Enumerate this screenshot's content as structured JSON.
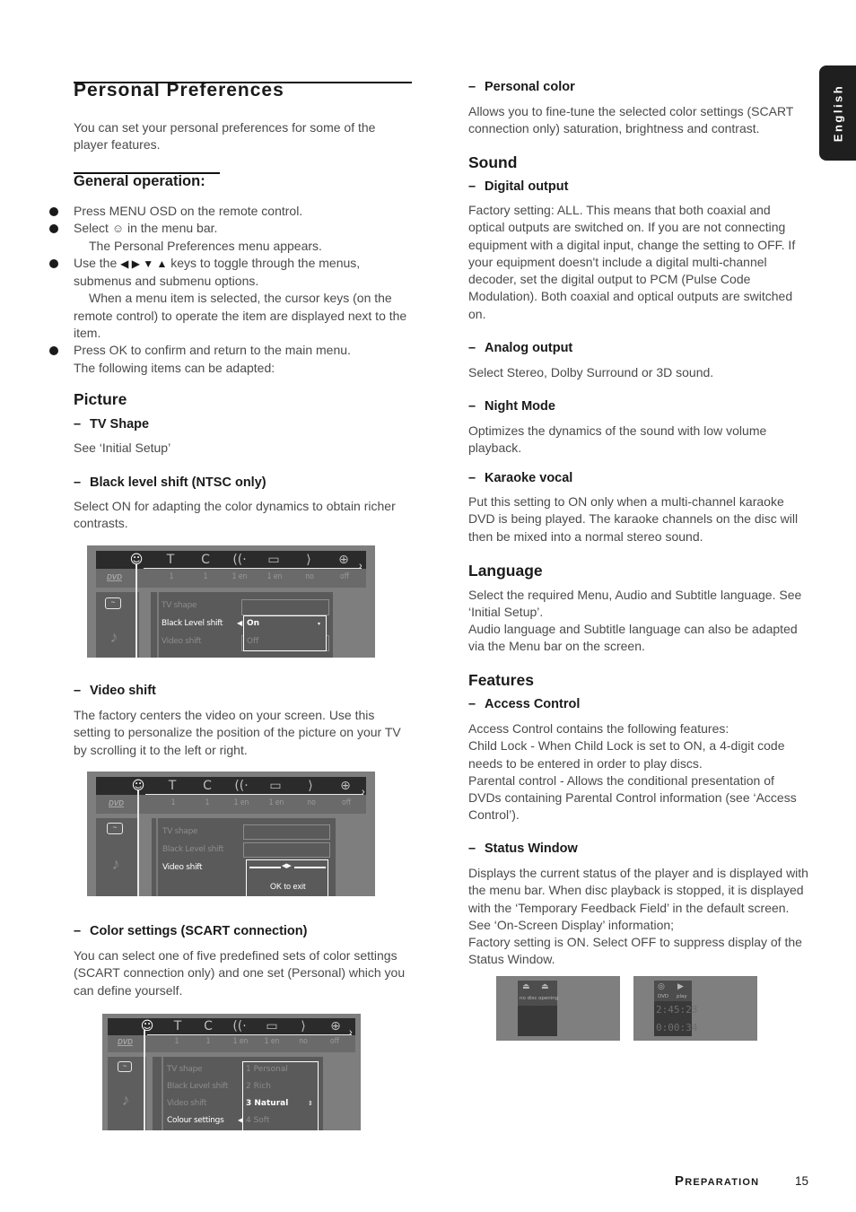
{
  "page": {
    "title": "Personal Preferences",
    "intro": "You can set your personal preferences for some of the player features.",
    "language_tab": "English",
    "footer": {
      "section": "Preparation",
      "page_number": "15"
    }
  },
  "general_operation": {
    "heading": "General operation:",
    "steps": [
      {
        "text": "Press MENU OSD on the remote control."
      },
      {
        "text_before": "Select",
        "icon": "personal-preferences-icon",
        "text_after": "in the menu bar.",
        "result": "The Personal Preferences menu appears."
      },
      {
        "text_before": "Use the",
        "keys": "◀ ▶ ▼ ▲",
        "text_after": "keys to toggle through the menus, submenus and submenu options.",
        "result": "When a menu item is selected, the cursor keys (on the remote control) to operate the item are displayed next to the item."
      },
      {
        "text": "Press OK to confirm and return to the main menu.",
        "note": "The following items can be adapted:"
      }
    ]
  },
  "picture": {
    "heading": "Picture",
    "tv_shape": {
      "title": "TV Shape",
      "text": "See ‘Initial Setup’"
    },
    "black_level": {
      "title": "Black level shift (NTSC only)",
      "text": "Select ON for adapting the color dynamics to obtain richer contrasts."
    },
    "video_shift": {
      "title": "Video shift",
      "text": "The factory centers the video on your screen. Use this setting to personalize the position of the picture on your TV by scrolling it to the left or right."
    },
    "color_settings": {
      "title": "Color settings (SCART connection)",
      "text": "You can select one of five predefined sets of color settings (SCART connection only) and one set (Personal) which you can define yourself."
    }
  },
  "osd": {
    "menu_icons": [
      "☺",
      "T",
      "C",
      "((·",
      "▭",
      "⟩",
      "⊕"
    ],
    "menu_icon_names": [
      "personal-preferences-icon",
      "title-icon",
      "chapter-icon",
      "audio-icon",
      "subtitle-icon",
      "angle-icon",
      "zoom-icon"
    ],
    "status_values": [
      "1",
      "1",
      "1 en",
      "1 en",
      "no",
      "off"
    ],
    "dvd_label": "DVD",
    "side_icons": [
      "picture-icon",
      "sound-icon"
    ],
    "screen1": {
      "items": [
        "TV shape",
        "Black Level shift",
        "Video shift"
      ],
      "active_index": 1,
      "options": [
        "On",
        "Off"
      ],
      "selected_option": "On"
    },
    "screen2": {
      "items": [
        "TV shape",
        "Black Level shift",
        "Video shift"
      ],
      "active_index": 2,
      "slider_hint": "OK to exit"
    },
    "screen3": {
      "items": [
        "TV shape",
        "Black Level shift",
        "Video shift",
        "Colour settings"
      ],
      "active_index": 3,
      "options": [
        "1 Personal",
        "2 Rich",
        "3 Natural",
        "4 Soft"
      ],
      "selected_option": "3 Natural"
    }
  },
  "right": {
    "personal_color": {
      "title": "Personal color",
      "text": "Allows you to fine-tune the selected color settings (SCART connection only) saturation, brightness and contrast."
    },
    "sound": {
      "heading": "Sound",
      "digital_output": {
        "title": "Digital output",
        "text": "Factory setting: ALL. This means that both coaxial and optical outputs are switched on. If you are not connecting equipment with a digital input, change the setting to OFF. If your equipment doesn't include a digital multi-channel decoder, set the digital output to PCM (Pulse Code Modulation). Both coaxial and optical outputs are switched on."
      },
      "analog_output": {
        "title": "Analog output",
        "text": "Select Stereo, Dolby Surround or 3D sound."
      },
      "night_mode": {
        "title": "Night Mode",
        "text": "Optimizes the dynamics of the sound with low volume playback."
      },
      "karaoke": {
        "title": "Karaoke vocal",
        "text": "Put this setting to ON only when a multi-channel karaoke DVD is being played. The karaoke channels on the disc will then be mixed into a normal stereo sound."
      }
    },
    "language": {
      "heading": "Language",
      "text1": "Select the required Menu, Audio and Subtitle language. See ‘Initial Setup’.",
      "text2": "Audio language and Subtitle language can also be adapted via the Menu bar on the screen."
    },
    "features": {
      "heading": "Features",
      "access_control": {
        "title": "Access Control",
        "lines": [
          "Access Control contains the following features:",
          "Child Lock - When Child Lock is set to ON, a 4-digit code needs to be entered in order to play discs.",
          "Parental control - Allows the conditional presentation of DVDs containing Parental Control information (see ‘Access Control’)."
        ]
      },
      "status_window": {
        "title": "Status Window",
        "lines": [
          "Displays the current status of the player and is displayed with the menu bar. When disc playback is stopped, it is displayed with the ‘Temporary Feedback Field’ in the default screen. See ‘On-Screen Display’ information;",
          "Factory setting is ON. Select OFF to suppress display of the Status Window."
        ]
      }
    },
    "status_images": [
      {
        "labels": [
          "no disc",
          "opening"
        ]
      },
      {
        "labels": [
          "DVD",
          "play"
        ],
        "time_total": "2:45:23",
        "time_elapsed": "0:00:34"
      }
    ]
  }
}
